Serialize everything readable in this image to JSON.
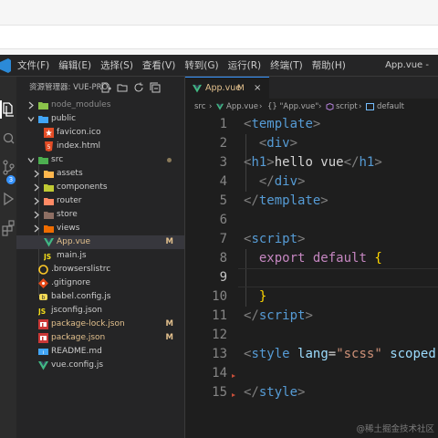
{
  "menu": [
    "文件(F)",
    "编辑(E)",
    "选择(S)",
    "查看(V)",
    "转到(G)",
    "运行(R)",
    "终端(T)",
    "帮助(H)"
  ],
  "window_title": "App.vue - ",
  "activity": {
    "scm_badge": "3"
  },
  "explorer": {
    "title": "资源管理器: VUE-PRO",
    "items": [
      {
        "label": "node_modules",
        "icon": "folder-node-icon",
        "status": ""
      },
      {
        "label": "public",
        "icon": "folder-public-icon",
        "status": ""
      },
      {
        "label": "favicon.ico",
        "icon": "favicon-icon",
        "status": ""
      },
      {
        "label": "index.html",
        "icon": "html5-icon",
        "status": ""
      },
      {
        "label": "src",
        "icon": "folder-src-icon",
        "status": ""
      },
      {
        "label": "assets",
        "icon": "folder-assets-icon",
        "status": ""
      },
      {
        "label": "components",
        "icon": "folder-components-icon",
        "status": ""
      },
      {
        "label": "router",
        "icon": "folder-router-icon",
        "status": ""
      },
      {
        "label": "store",
        "icon": "folder-store-icon",
        "status": ""
      },
      {
        "label": "views",
        "icon": "folder-views-icon",
        "status": ""
      },
      {
        "label": "App.vue",
        "icon": "vue-icon",
        "status": "M"
      },
      {
        "label": "main.js",
        "icon": "js-icon",
        "status": ""
      },
      {
        "label": ".browserslistrc",
        "icon": "browserslist-icon",
        "status": ""
      },
      {
        "label": ".gitignore",
        "icon": "git-icon",
        "status": ""
      },
      {
        "label": "babel.config.js",
        "icon": "babel-icon",
        "status": ""
      },
      {
        "label": "jsconfig.json",
        "icon": "jsconfig-icon",
        "status": ""
      },
      {
        "label": "package-lock.json",
        "icon": "npm-icon",
        "status": "M"
      },
      {
        "label": "package.json",
        "icon": "npm-icon",
        "status": "M"
      },
      {
        "label": "README.md",
        "icon": "readme-icon",
        "status": ""
      },
      {
        "label": "vue.config.js",
        "icon": "vue-config-icon",
        "status": ""
      }
    ]
  },
  "tab": {
    "label": "App.vue",
    "status": "M",
    "close": "×"
  },
  "breadcrumb": {
    "part1": "src",
    "sep": "›",
    "part2": "App.vue",
    "part3": "{} \"App.vue\"",
    "part4": "script",
    "part5": "default"
  },
  "code": {
    "line_numbers": [
      "1",
      "2",
      "3",
      "4",
      "5",
      "6",
      "7",
      "8",
      "9",
      "10",
      "11",
      "12",
      "13",
      "14",
      "15"
    ],
    "tokens": {
      "l1_open": "<",
      "l1_tag": "template",
      "l1_close": ">",
      "l2_open": "<",
      "l2_tag": "div",
      "l2_close": ">",
      "l3_open": "<",
      "l3_tag": "h1",
      "l3_close": ">",
      "l3_text": "hello vue",
      "l3_open2": "</",
      "l3_tag2": "h1",
      "l3_close2": ">",
      "l4_open": "</",
      "l4_tag": "div",
      "l4_close": ">",
      "l5_open": "</",
      "l5_tag": "template",
      "l5_close": ">",
      "l7_open": "<",
      "l7_tag": "script",
      "l7_close": ">",
      "l8_kw1": "export",
      "l8_kw2": "default",
      "l8_brace": "{",
      "l10_brace": "}",
      "l11_open": "</",
      "l11_tag": "script",
      "l11_close": ">",
      "l13_open": "<",
      "l13_tag": "style",
      "l13_attr": "lang",
      "l13_eq": "=",
      "l13_val": "\"scss\"",
      "l13_attr2": "scoped",
      "l15_open": "</",
      "l15_tag": "style",
      "l15_close": ">"
    }
  },
  "watermark": "@稀土掘金技术社区",
  "colors": {
    "accent": "#3794ff",
    "modified": "#e2c08d",
    "tag": "#569cd6",
    "keyword": "#c586c0"
  }
}
